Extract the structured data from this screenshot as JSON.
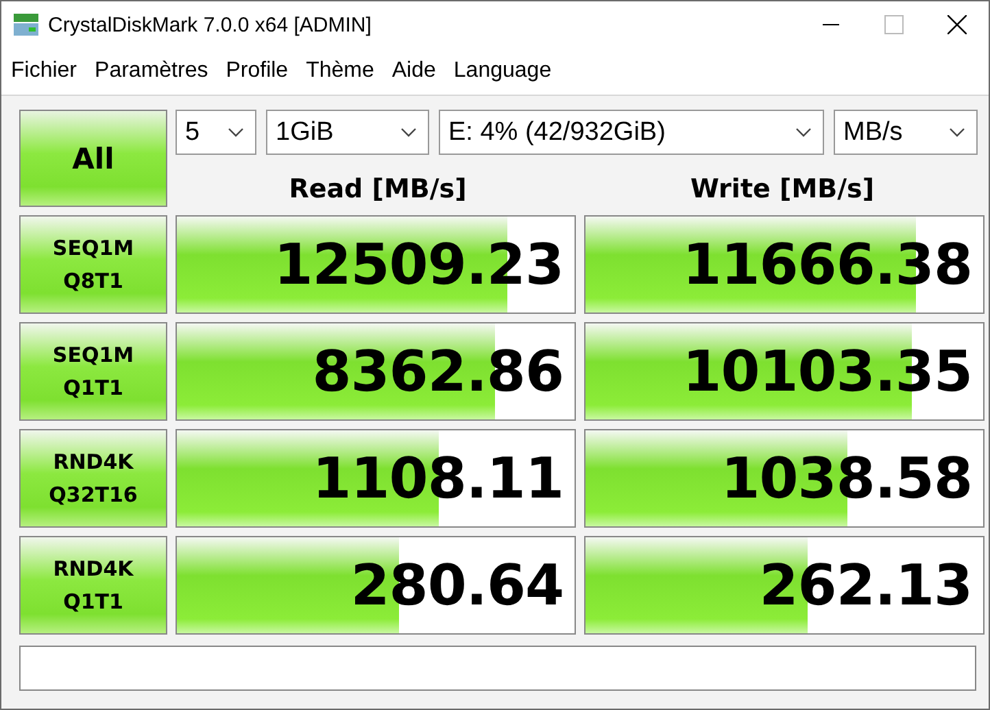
{
  "window": {
    "title": "CrystalDiskMark 7.0.0 x64 [ADMIN]"
  },
  "menu": [
    "Fichier",
    "Paramètres",
    "Profile",
    "Thème",
    "Aide",
    "Language"
  ],
  "all_button": "All",
  "selects": [
    {
      "value": "5"
    },
    {
      "value": "1GiB"
    },
    {
      "value": "E: 4% (42/932GiB)"
    },
    {
      "value": "MB/s"
    }
  ],
  "columns": [
    "Read [MB/s]",
    "Write [MB/s]"
  ],
  "rows": [
    {
      "label": [
        "SEQ1M",
        "Q8T1"
      ],
      "read": {
        "value": "12509.23",
        "level": 0.83
      },
      "write": {
        "value": "11666.38",
        "level": 0.83
      }
    },
    {
      "label": [
        "SEQ1M",
        "Q1T1"
      ],
      "read": {
        "value": "8362.86",
        "level": 0.8
      },
      "write": {
        "value": "10103.35",
        "level": 0.82
      }
    },
    {
      "label": [
        "RND4K",
        "Q32T16"
      ],
      "read": {
        "value": "1108.11",
        "level": 0.66
      },
      "write": {
        "value": "1038.58",
        "level": 0.66
      }
    },
    {
      "label": [
        "RND4K",
        "Q1T1"
      ],
      "read": {
        "value": "280.64",
        "level": 0.56
      },
      "write": {
        "value": "262.13",
        "level": 0.56
      }
    }
  ]
}
